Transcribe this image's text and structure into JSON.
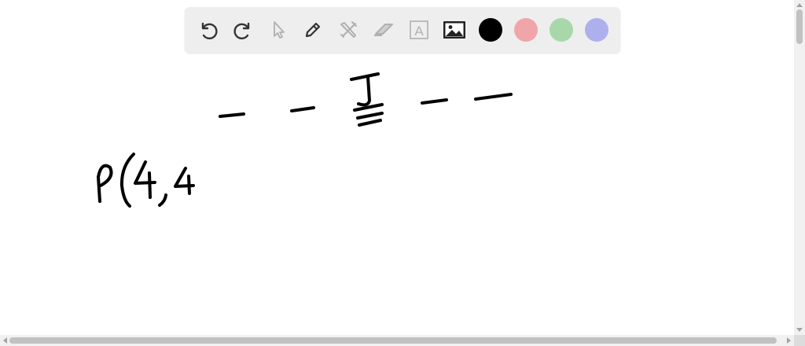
{
  "toolbar": {
    "tools": [
      {
        "name": "undo",
        "icon": "undo-icon",
        "enabled": true
      },
      {
        "name": "redo",
        "icon": "redo-icon",
        "enabled": true
      },
      {
        "name": "select",
        "icon": "pointer-icon",
        "enabled": false
      },
      {
        "name": "pen",
        "icon": "pen-icon",
        "enabled": true
      },
      {
        "name": "tools",
        "icon": "crossed-tools-icon",
        "enabled": false
      },
      {
        "name": "eraser",
        "icon": "eraser-icon",
        "enabled": false
      },
      {
        "name": "text",
        "icon": "text-box-icon",
        "label": "A",
        "enabled": false
      },
      {
        "name": "image",
        "icon": "image-icon",
        "enabled": true
      }
    ],
    "colors": [
      {
        "name": "black",
        "hex": "#000000",
        "selected": true
      },
      {
        "name": "red",
        "hex": "#f0a6a8"
      },
      {
        "name": "green",
        "hex": "#a8d8a9"
      },
      {
        "name": "blue",
        "hex": "#aeb0ee"
      }
    ]
  },
  "canvas": {
    "ink_color": "#000000",
    "handwriting": {
      "blanks": [
        "_",
        "_",
        "_",
        "_"
      ],
      "middle_letter": "J",
      "expression": "P(4,4"
    }
  }
}
